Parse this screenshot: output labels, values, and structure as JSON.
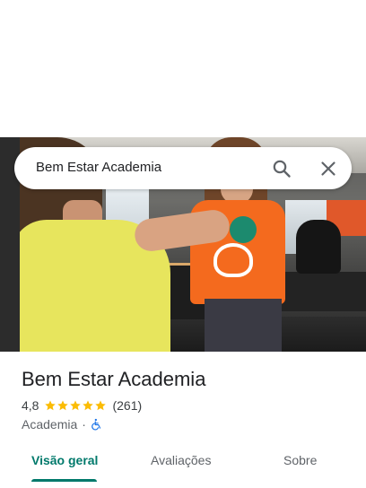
{
  "search": {
    "query": "Bem Estar Academia"
  },
  "place": {
    "name": "Bem Estar Academia",
    "rating": "4,8",
    "stars": 5,
    "review_count": "(261)",
    "category": "Academia",
    "separator": "·"
  },
  "tabs": [
    {
      "label": "Visão geral",
      "active": true
    },
    {
      "label": "Avaliações",
      "active": false
    },
    {
      "label": "Sobre",
      "active": false
    }
  ],
  "colors": {
    "accent": "#00796b",
    "star": "#fbbc04",
    "accessible_icon": "#1a73e8"
  },
  "icons": {
    "search": "search-icon",
    "close": "close-icon",
    "star": "star-icon",
    "accessibility": "wheelchair-icon"
  }
}
